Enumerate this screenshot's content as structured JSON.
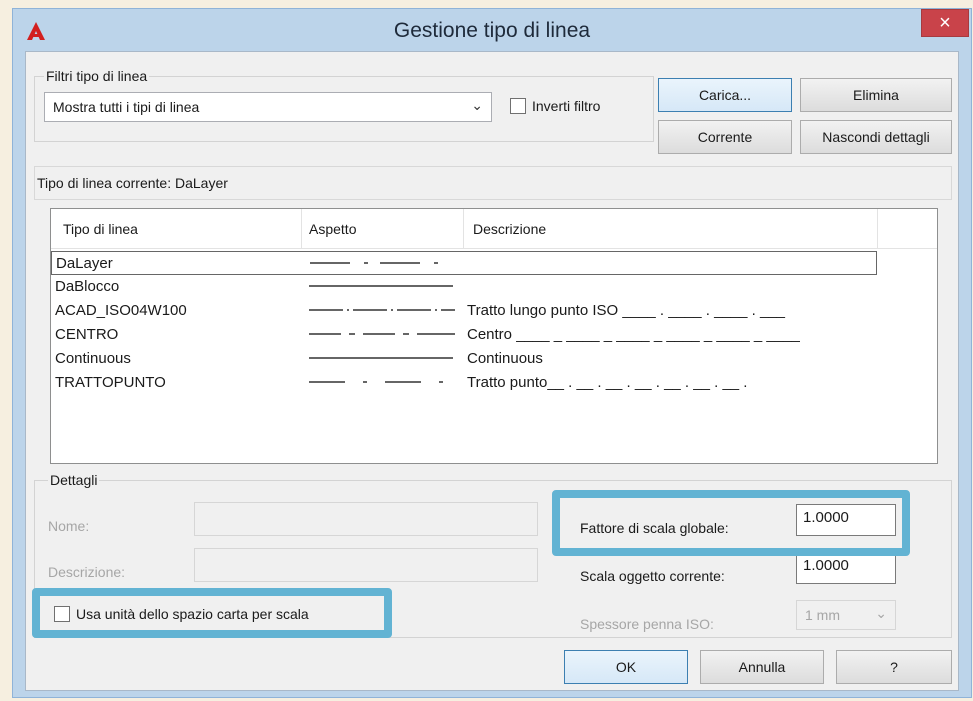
{
  "window": {
    "title": "Gestione tipo di linea",
    "close": "×"
  },
  "filter": {
    "legend": "Filtri tipo di linea",
    "selected": "Mostra tutti i tipi di linea",
    "invert_label": "Inverti filtro"
  },
  "buttons": {
    "load": "Carica...",
    "delete": "Elimina",
    "current": "Corrente",
    "hide_details": "Nascondi dettagli",
    "ok": "OK",
    "cancel": "Annulla",
    "help": "?"
  },
  "current_linetype": "Tipo di linea corrente:  DaLayer",
  "list": {
    "columns": [
      "Tipo di linea",
      "Aspetto",
      "Descrizione"
    ],
    "rows": [
      {
        "name": "DaLayer",
        "pattern": "dashdot",
        "description": ""
      },
      {
        "name": "DaBlocco",
        "pattern": "continuous",
        "description": ""
      },
      {
        "name": "ACAD_ISO04W100",
        "pattern": "longdash",
        "description": "Tratto lungo punto ISO ____ . ____ . ____ . ___"
      },
      {
        "name": "CENTRO",
        "pattern": "center",
        "description": "Centro ____ _ ____ _ ____ _ ____ _ ____ _ ____"
      },
      {
        "name": "Continuous",
        "pattern": "continuous",
        "description": "Continuous"
      },
      {
        "name": "TRATTOPUNTO",
        "pattern": "dashdot",
        "description": "Tratto punto__ . __ . __ . __ . __ . __ . __ ."
      }
    ]
  },
  "details": {
    "legend": "Dettagli",
    "name_label": "Nome:",
    "description_label": "Descrizione:",
    "paper_space_label": "Usa unità dello spazio carta per scala",
    "global_scale_label": "Fattore di scala globale:",
    "global_scale_value": "1.0000",
    "object_scale_label": "Scala oggetto corrente:",
    "object_scale_value": "1.0000",
    "pen_width_label": "Spessore penna ISO:",
    "pen_width_value": "1 mm"
  },
  "colors": {
    "highlight": "#62b3d3",
    "title_bar": "#bcd4ea",
    "close": "#c9434a"
  }
}
